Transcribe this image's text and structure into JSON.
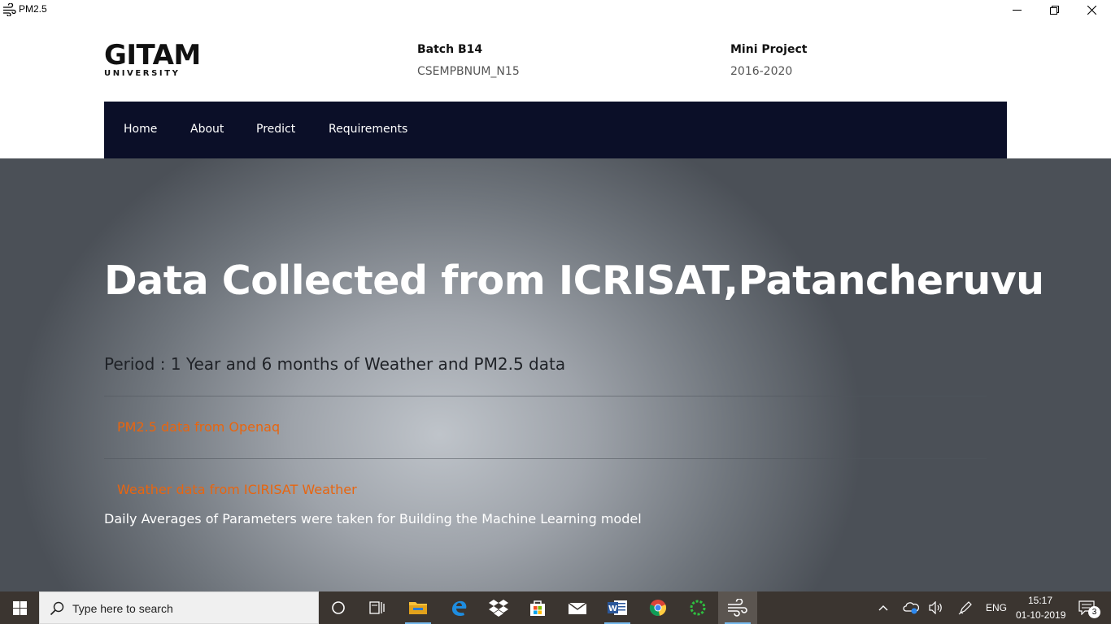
{
  "window": {
    "title": "PM2.5",
    "controls": [
      "minimize",
      "restore",
      "close"
    ]
  },
  "header": {
    "logo_main": "GITAM",
    "logo_sub": "UNIVERSITY",
    "batch_title": "Batch B14",
    "batch_value": "CSEMPBNUM_N15",
    "project_title": "Mini Project",
    "project_value": "2016-2020"
  },
  "nav": {
    "items": [
      "Home",
      "About",
      "Predict",
      "Requirements"
    ]
  },
  "hero": {
    "title": "Data Collected from ICRISAT,Patancheruvu",
    "period": "Period : 1 Year and 6 months of Weather and PM2.5 data",
    "links": [
      "PM2.5 data from Openaq",
      "Weather data from ICIRISAT Weather"
    ],
    "note": "Daily Averages of Parameters were taken for Building the Machine Learning model"
  },
  "colors": {
    "nav_bg": "#0b0f28",
    "link": "#e8650f",
    "taskbar": "#3b3530"
  },
  "taskbar": {
    "search_placeholder": "Type here to search",
    "apps": [
      "cortana-icon",
      "task-view-icon",
      "file-explorer-icon",
      "edge-icon",
      "dropbox-icon",
      "store-icon",
      "mail-icon",
      "word-icon",
      "chrome-icon",
      "loader-icon",
      "pm25-app-icon"
    ],
    "language": "ENG",
    "time": "15:17",
    "date": "01-10-2019",
    "notification_count": "3"
  }
}
